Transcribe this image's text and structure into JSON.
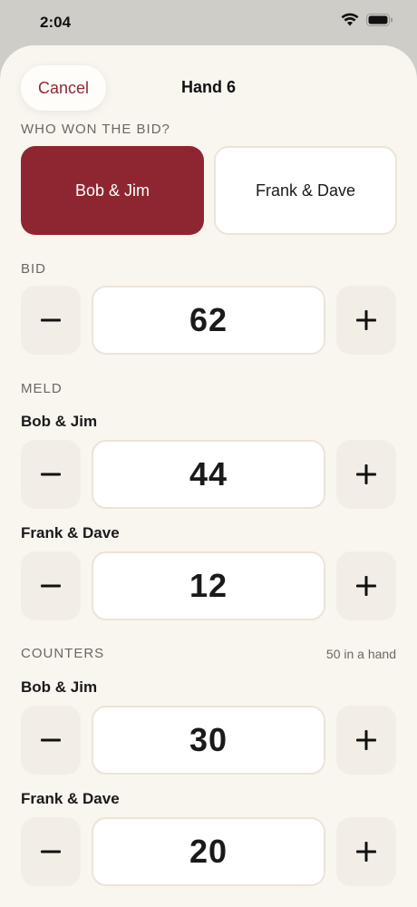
{
  "status": {
    "time": "2:04"
  },
  "header": {
    "cancel_label": "Cancel",
    "title": "Hand 6"
  },
  "bid_winner": {
    "label": "WHO WON THE BID?",
    "options": [
      "Bob & Jim",
      "Frank & Dave"
    ],
    "selected": "Bob & Jim"
  },
  "bid": {
    "label": "BID",
    "value": "62"
  },
  "meld": {
    "label": "MELD",
    "team1": {
      "name": "Bob & Jim",
      "value": "44"
    },
    "team2": {
      "name": "Frank & Dave",
      "value": "12"
    }
  },
  "counters": {
    "label": "COUNTERS",
    "hint": "50 in a hand",
    "team1": {
      "name": "Bob & Jim",
      "value": "30"
    },
    "team2": {
      "name": "Frank & Dave",
      "value": "20"
    }
  },
  "icons": {
    "decrement": "minus-icon",
    "increment": "plus-icon"
  },
  "colors": {
    "accent": "#8e2632",
    "sheet_bg": "#f9f5ef",
    "stepper_bg": "#f3eee5"
  }
}
